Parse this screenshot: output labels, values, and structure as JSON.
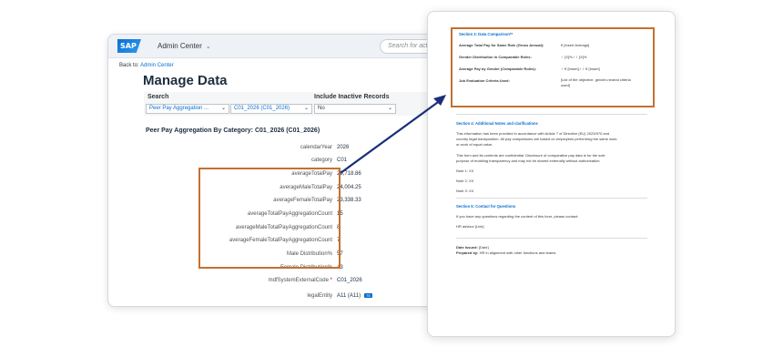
{
  "shell": {
    "logo": "SAP",
    "app_title": "Admin Center",
    "search_placeholder": "Search for actio"
  },
  "nav": {
    "back_prefix": "Back to:",
    "back_link": "Admin Center"
  },
  "page": {
    "title": "Manage Data"
  },
  "search": {
    "label": "Search",
    "inactive_label": "Include Inactive Records",
    "object_type": "Peer Pay Aggregation ...",
    "object_value": "C01_2026 (C01_2026)",
    "inactive_value": "No"
  },
  "record": {
    "title": "Peer Pay Aggregation By Category: C01_2026 (C01_2026)",
    "fields": [
      {
        "key": "calendarYear",
        "value": "2026"
      },
      {
        "key": "category",
        "value": "C01"
      },
      {
        "key": "averageTotalPay",
        "value": "23,718.86"
      },
      {
        "key": "averageMaleTotalPay",
        "value": "24,004.25"
      },
      {
        "key": "averageFemaleTotalPay",
        "value": "23,338.33"
      },
      {
        "key": "averageTotalPayAggregationCount",
        "value": "15"
      },
      {
        "key": "averageMaleTotalPayAggregationCount",
        "value": "8"
      },
      {
        "key": "averageFemaleTotalPayAggregationCount",
        "value": "7"
      },
      {
        "key": "Male Distribution%",
        "value": "57"
      },
      {
        "key": "Female Distribution%",
        "value": "43"
      },
      {
        "key": "mdfSystemExternalCode",
        "value": "C01_2026",
        "required": "*"
      },
      {
        "key": "legalEntity",
        "value": "A11 (A11)",
        "tag": "75"
      }
    ]
  },
  "document": {
    "s3_title": "Section 3: Data Comparison**",
    "s3_rows": [
      {
        "label": "Average Total Pay for Same Role (Gross Annual):",
        "value": "€ [Insert Average]"
      },
      {
        "label": "Gender Distribution in Comparable Roles:",
        "value": "♂ [X]% / ♀ [X]%"
      },
      {
        "label": "Average Pay by Gender (Comparable Roles):",
        "value": "♂ € [Insert] / ♀ € [Insert]"
      },
      {
        "label": "Job Evaluation Criteria Used:",
        "value": "[List of the objective, gender-neutral criteria"
      },
      {
        "label": "",
        "value": "used]"
      }
    ],
    "s4_title": "Section 4: Additional Notes and clarifications",
    "s4_lines": [
      "This information has been provided in accordance with Article 7 of Directive (EU) 2023/970 and",
      "country legal transposition. All pay comparisons are based on employees performing the same work",
      "or work of equal value.",
      "This form and its contents are confidential. Disclosure of comparative pay data is for the sole",
      "purpose of enabling transparency and may not be shared externally without authorization.",
      "Note 1: XX",
      "Note 2: XX",
      "Note 3: XX"
    ],
    "s5_title": "Section 5: Contact for Questions",
    "s5_lines": [
      "If you have any questions regarding the content of this form, please contact:",
      "HR advisor [Link]"
    ],
    "date_issued_label": "Date Issued:",
    "date_issued_value": "[Date]",
    "prepared_by_label": "Prepared by:",
    "prepared_by_value": "HR in alignment with other functions and teams"
  },
  "colors": {
    "highlight": "#c5702f",
    "arrow": "#1a2f7a",
    "link": "#0a6ed1"
  }
}
